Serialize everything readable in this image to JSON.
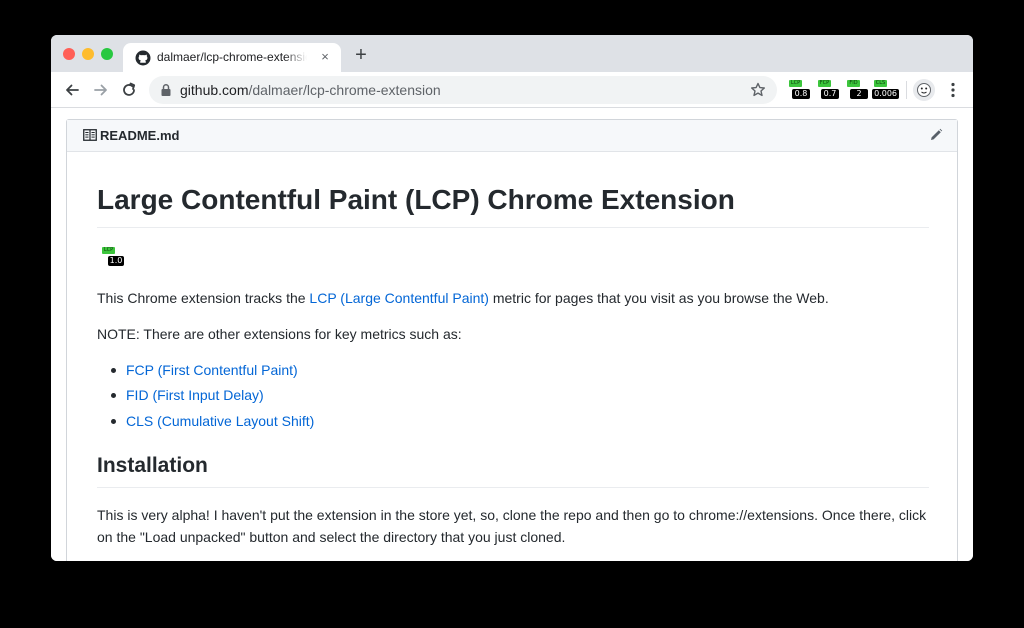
{
  "browser": {
    "tab_title": "dalmaer/lcp-chrome-extension: A",
    "tab_close": "×",
    "new_tab": "+",
    "url_host": "github.com",
    "url_path": "/dalmaer/lcp-chrome-extension",
    "extensions": [
      {
        "name": "LCP",
        "value": "0.8"
      },
      {
        "name": "FCP",
        "value": "0.7"
      },
      {
        "name": "FID",
        "value": "2"
      },
      {
        "name": "CLS",
        "value": "0.006"
      }
    ],
    "colors": {
      "badge_green": "#3cc53c",
      "tabstrip": "#dee1e6"
    }
  },
  "readme": {
    "filename": "README.md",
    "title": "Large Contentful Paint (LCP) Chrome Extension",
    "badge": {
      "name": "LCP",
      "value": "1.0"
    },
    "intro_before": "This Chrome extension tracks the ",
    "intro_link": "LCP (Large Contentful Paint)",
    "intro_after": " metric for pages that you visit as you browse the Web.",
    "note": "NOTE: There are other extensions for key metrics such as:",
    "links": [
      "FCP (First Contentful Paint)",
      "FID (First Input Delay)",
      "CLS (Cumulative Layout Shift)"
    ],
    "installation_heading": "Installation",
    "installation_text": "This is very alpha! I haven't put the extension in the store yet, so, clone the repo and then go to chrome://extensions. Once there, click on the \"Load unpacked\" button and select the directory that you just cloned.",
    "link_color": "#0366d6"
  }
}
